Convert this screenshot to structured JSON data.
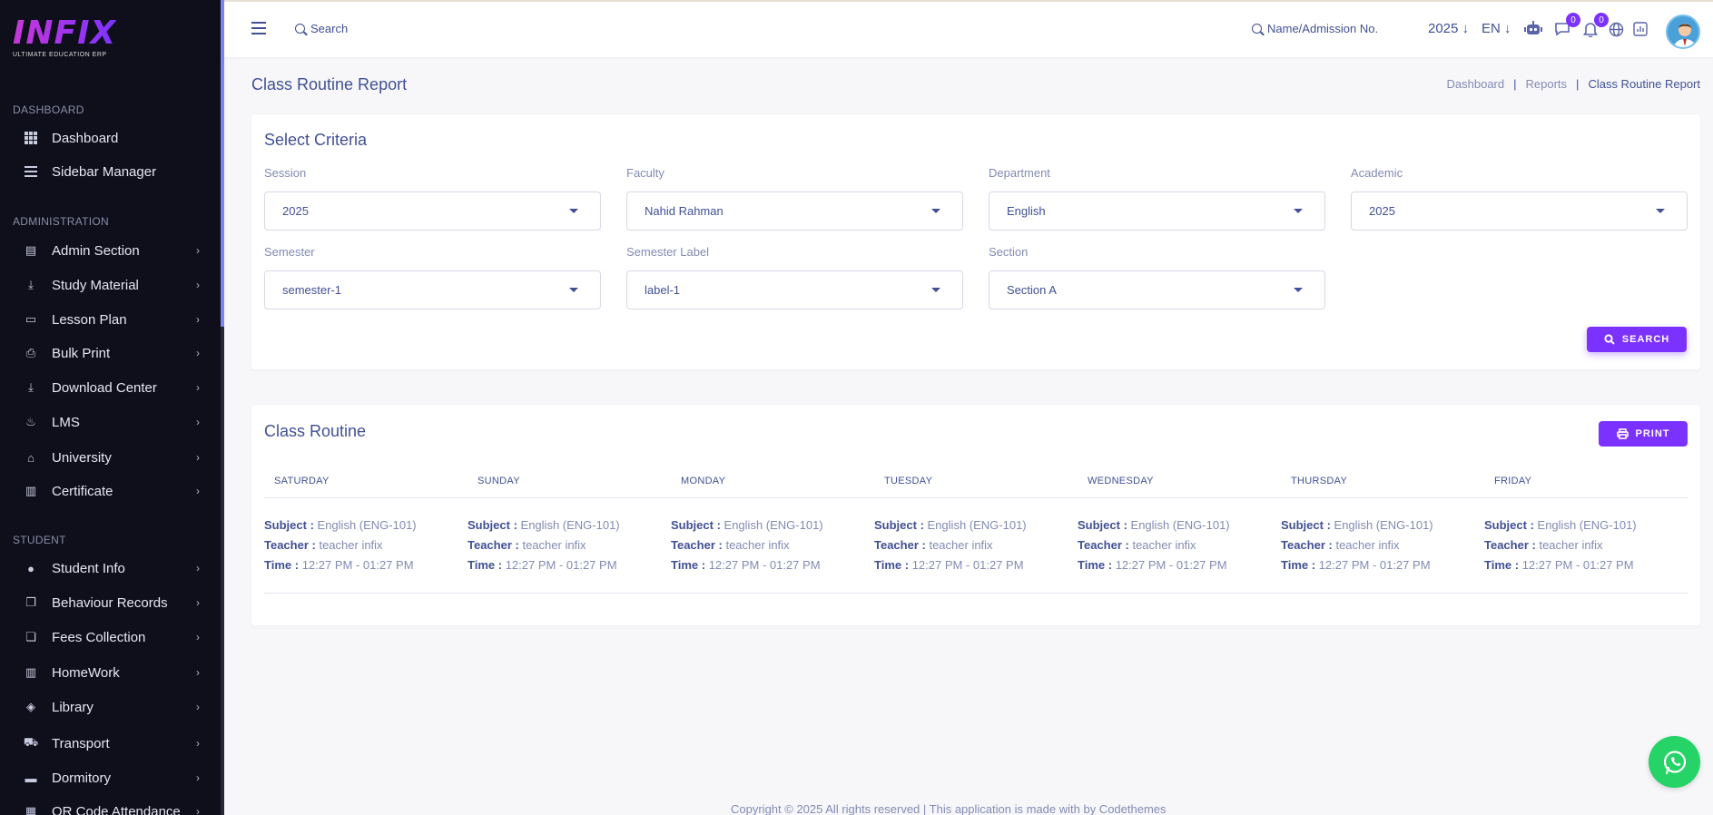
{
  "logo": {
    "text": "INFIX",
    "subtitle": "ULTIMATE EDUCATION ERP"
  },
  "sidebar": {
    "sections": [
      {
        "label": "DASHBOARD"
      },
      {
        "label": "ADMINISTRATION"
      },
      {
        "label": "STUDENT"
      }
    ],
    "items": [
      {
        "label": "Dashboard",
        "icon": "grid-icon"
      },
      {
        "label": "Sidebar Manager",
        "icon": "list-icon"
      },
      {
        "label": "Admin Section",
        "icon": "admin-icon"
      },
      {
        "label": "Study Material",
        "icon": "download-icon"
      },
      {
        "label": "Lesson Plan",
        "icon": "lesson-icon"
      },
      {
        "label": "Bulk Print",
        "icon": "printer-icon"
      },
      {
        "label": "Download Center",
        "icon": "download-icon"
      },
      {
        "label": "LMS",
        "icon": "lms-icon"
      },
      {
        "label": "University",
        "icon": "university-icon"
      },
      {
        "label": "Certificate",
        "icon": "book-icon"
      },
      {
        "label": "Student Info",
        "icon": "user-icon"
      },
      {
        "label": "Behaviour Records",
        "icon": "records-icon"
      },
      {
        "label": "Fees Collection",
        "icon": "fees-icon"
      },
      {
        "label": "HomeWork",
        "icon": "book-icon"
      },
      {
        "label": "Library",
        "icon": "library-icon"
      },
      {
        "label": "Transport",
        "icon": "bus-icon"
      },
      {
        "label": "Dormitory",
        "icon": "bed-icon"
      },
      {
        "label": "QR Code Attendance",
        "icon": "qr-icon"
      }
    ]
  },
  "header": {
    "search_label": "Search",
    "student_search_label": "Name/Admission No.",
    "year": "2025",
    "language": "EN",
    "chat_badge": "0",
    "notification_badge": "0"
  },
  "page": {
    "title": "Class Routine Report",
    "breadcrumb": [
      "Dashboard",
      "Reports",
      "Class Routine Report"
    ],
    "breadcrumb_sep": "|"
  },
  "criteria": {
    "title": "Select Criteria",
    "fields": [
      {
        "label": "Session",
        "value": "2025"
      },
      {
        "label": "Faculty",
        "value": "Nahid Rahman"
      },
      {
        "label": "Department",
        "value": "English"
      },
      {
        "label": "Academic",
        "value": "2025"
      },
      {
        "label": "Semester",
        "value": "semester-1"
      },
      {
        "label": "Semester Label",
        "value": "label-1"
      },
      {
        "label": "Section",
        "value": "Section A"
      }
    ],
    "search_button": "SEARCH"
  },
  "routine": {
    "title": "Class Routine",
    "print_button": "PRINT",
    "subject_label": "Subject :",
    "teacher_label": "Teacher :",
    "time_label": "Time :",
    "days": [
      {
        "day": "SATURDAY",
        "subject": "English (ENG-101)",
        "teacher": "teacher infix",
        "time": "12:27 PM - 01:27 PM"
      },
      {
        "day": "SUNDAY",
        "subject": "English (ENG-101)",
        "teacher": "teacher infix",
        "time": "12:27 PM - 01:27 PM"
      },
      {
        "day": "MONDAY",
        "subject": "English (ENG-101)",
        "teacher": "teacher infix",
        "time": "12:27 PM - 01:27 PM"
      },
      {
        "day": "TUESDAY",
        "subject": "English (ENG-101)",
        "teacher": "teacher infix",
        "time": "12:27 PM - 01:27 PM"
      },
      {
        "day": "WEDNESDAY",
        "subject": "English (ENG-101)",
        "teacher": "teacher infix",
        "time": "12:27 PM - 01:27 PM"
      },
      {
        "day": "THURSDAY",
        "subject": "English (ENG-101)",
        "teacher": "teacher infix",
        "time": "12:27 PM - 01:27 PM"
      },
      {
        "day": "FRIDAY",
        "subject": "English (ENG-101)",
        "teacher": "teacher infix",
        "time": "12:27 PM - 01:27 PM"
      }
    ]
  },
  "footer": {
    "text": "Copyright © 2025 All rights reserved | This application is made with by Codethemes"
  },
  "colors": {
    "primary": "#7c32ff",
    "text": "#415094",
    "muted": "#828bb2",
    "sidebar": "#0e0f1a",
    "whatsapp": "#25d366"
  }
}
